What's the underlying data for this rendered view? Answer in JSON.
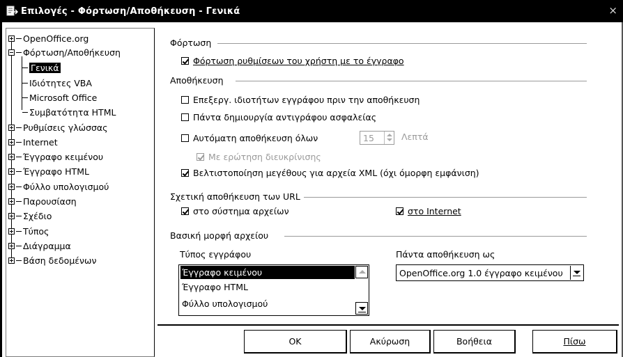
{
  "window": {
    "title": "Επιλογές - Φόρτωση/Αποθήκευση - Γενικά",
    "close_glyph": "×",
    "icons": [
      "app-icon",
      "close-icon"
    ]
  },
  "tree": {
    "items": [
      {
        "label": "OpenOffice.org",
        "expander": "plus"
      },
      {
        "label": "Φόρτωση/Αποθήκευση",
        "expander": "minus"
      },
      {
        "label": "Γενικά",
        "selected": true
      },
      {
        "label": "Ιδιότητες VBA"
      },
      {
        "label": "Microsoft Office"
      },
      {
        "label": "Συμβατότητα HTML"
      },
      {
        "label": "Ρυθμίσεις γλώσσας",
        "expander": "plus"
      },
      {
        "label": "Internet",
        "expander": "plus"
      },
      {
        "label": "Έγγραφο κειμένου",
        "expander": "plus"
      },
      {
        "label": "Έγγραφο HTML",
        "expander": "plus"
      },
      {
        "label": "Φύλλο υπολογισμού",
        "expander": "plus"
      },
      {
        "label": "Παρουσίαση",
        "expander": "plus"
      },
      {
        "label": "Σχέδιο",
        "expander": "plus"
      },
      {
        "label": "Τύπος",
        "expander": "plus"
      },
      {
        "label": "Διάγραμμα",
        "expander": "plus"
      },
      {
        "label": "Βάση δεδομένων",
        "expander": "plus"
      }
    ]
  },
  "load": {
    "heading": "Φόρτωση",
    "user_settings": {
      "label": "Φόρτωση ρυθμίσεων του χρήστη με το έγγραφο",
      "checked": true
    }
  },
  "save": {
    "heading": "Αποθήκευση",
    "edit_props": {
      "label": "Επεξεργ. ιδιοτήτων εγγράφου πριν την αποθήκευση",
      "checked": false
    },
    "backup": {
      "label": "Πάντα δημιουργία αντιγράφου ασφαλείας",
      "checked": false
    },
    "autosave": {
      "label": "Αυτόματη αποθήκευση όλων",
      "checked": false,
      "minutes": "15",
      "unit": "Λεπτά"
    },
    "prompt": {
      "label": "Με ερώτηση διευκρίνισης",
      "checked": true,
      "disabled": true
    },
    "xml_size": {
      "label": "Βελτιστοποίηση μεγέθους για αρχεία XML (όχι όμορφη εμφάνιση)",
      "checked": true
    }
  },
  "relative": {
    "heading": "Σχετική αποθήκευση των URL",
    "filesystem": {
      "label": "στο σύστημα αρχείων",
      "checked": true
    },
    "internet": {
      "label": "στο Internet",
      "checked": true
    }
  },
  "format": {
    "heading": "Βασική μορφή αρχείου",
    "doctype_label": "Τύπος εγγράφου",
    "doctypes": [
      "Έγγραφο κειμένου",
      "Έγγραφο HTML",
      "Φύλλο υπολογισμού"
    ],
    "selected_doctype": "Έγγραφο κειμένου",
    "always_save_label": "Πάντα αποθήκευση ως",
    "always_save_value": "OpenOffice.org 1.0 έγγραφο κειμένου"
  },
  "buttons": {
    "ok": "OK",
    "cancel": "Ακύρωση",
    "help": "Βοήθεια",
    "back": "Πίσω"
  },
  "colors": {
    "title_bar": "#000000",
    "selection": "#000000",
    "disabled_text": "#9a9a9a"
  }
}
